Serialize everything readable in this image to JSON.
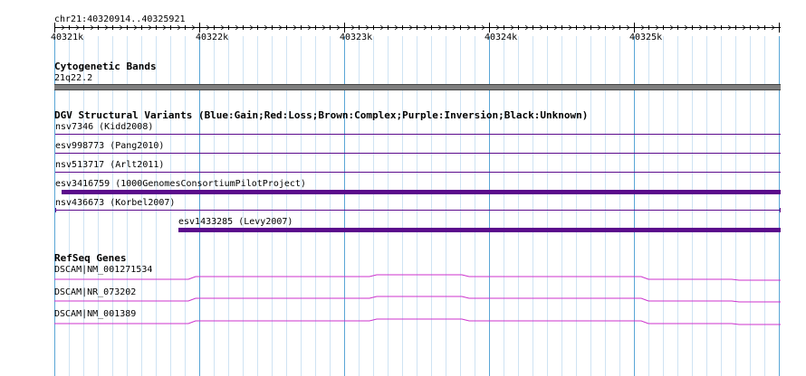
{
  "ruler": {
    "location": "chr21:40320914..40325921",
    "ticks": [
      "40321k",
      "40322k",
      "40323k",
      "40324k",
      "40325k"
    ]
  },
  "tracks": {
    "cytoband": {
      "title": "Cytogenetic Bands",
      "band": "21q22.2",
      "color": "#7f7f7f"
    },
    "dgv": {
      "title": "DGV Structural Variants (Blue:Gain;Red:Loss;Brown:Complex;Purple:Inversion;Black:Unknown)",
      "color": "#5b0a8c",
      "features": [
        {
          "label": "nsv7346 (Kidd2008)",
          "style": "line"
        },
        {
          "label": "esv998773 (Pang2010)",
          "style": "line"
        },
        {
          "label": "nsv513717 (Arlt2011)",
          "style": "line"
        },
        {
          "label": "esv3416759 (1000GenomesConsortiumPilotProject)",
          "style": "thick"
        },
        {
          "label": "nsv436673 (Korbel2007)",
          "style": "line-caps"
        },
        {
          "label": "esv1433285 (Levy2007)",
          "style": "thick"
        }
      ]
    },
    "refseq": {
      "title": "RefSeq Genes",
      "color": "#cc33cc",
      "features": [
        {
          "label": "DSCAM|NM_001271534"
        },
        {
          "label": "DSCAM|NR_073202"
        },
        {
          "label": "DSCAM|NM_001389"
        }
      ]
    }
  }
}
